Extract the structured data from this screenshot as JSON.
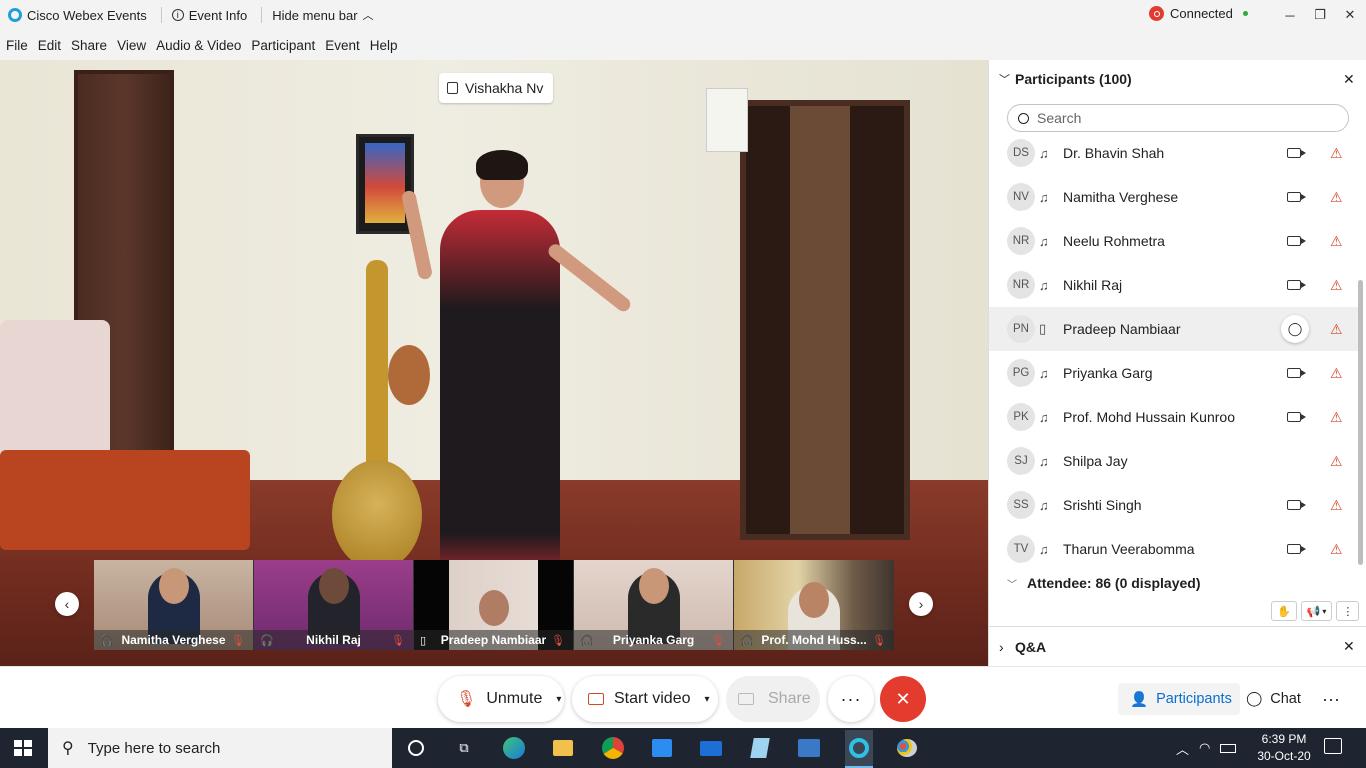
{
  "titlebar": {
    "app_name": "Cisco Webex Events",
    "event_info": "Event Info",
    "hide_menu": "Hide menu bar",
    "status": "Connected",
    "colors": {
      "status_dot": "#2bab3a",
      "record_red": "#e03c31"
    }
  },
  "menu": [
    "File",
    "Edit",
    "Share",
    "View",
    "Audio & Video",
    "Participant",
    "Event",
    "Help"
  ],
  "stage": {
    "active_speaker": "Vishakha Nv",
    "thumbnails": [
      {
        "name": "Namitha Verghese",
        "icon": "headset-icon"
      },
      {
        "name": "Nikhil Raj",
        "icon": "headset-icon"
      },
      {
        "name": "Pradeep Nambiaar",
        "icon": "phone-icon"
      },
      {
        "name": "Priyanka Garg",
        "icon": "headset-icon"
      },
      {
        "name": "Prof. Mohd Huss...",
        "icon": "headset-icon"
      }
    ]
  },
  "participants_panel": {
    "title": "Participants (100)",
    "search_placeholder": "Search",
    "rows": [
      {
        "initials": "DS",
        "name": "Dr. Bhavin Shah",
        "audio": "headset-icon",
        "video": true,
        "chat": false
      },
      {
        "initials": "NV",
        "name": "Namitha Verghese",
        "audio": "headset-icon",
        "video": true,
        "chat": false
      },
      {
        "initials": "NR",
        "name": "Neelu Rohmetra",
        "audio": "headset-icon",
        "video": true,
        "chat": false
      },
      {
        "initials": "NR",
        "name": "Nikhil Raj",
        "audio": "headset-icon",
        "video": true,
        "chat": false
      },
      {
        "initials": "PN",
        "name": "Pradeep Nambiaar",
        "audio": "phone-icon",
        "video": false,
        "chat": true,
        "selected": true
      },
      {
        "initials": "PG",
        "name": "Priyanka Garg",
        "audio": "headset-icon",
        "video": true,
        "chat": false
      },
      {
        "initials": "PK",
        "name": "Prof. Mohd Hussain Kunroo",
        "audio": "headset-icon",
        "video": true,
        "chat": false
      },
      {
        "initials": "SJ",
        "name": "Shilpa Jay",
        "audio": "headset-icon",
        "video": false,
        "chat": false
      },
      {
        "initials": "SS",
        "name": "Srishti Singh",
        "audio": "headset-icon",
        "video": true,
        "chat": false
      },
      {
        "initials": "TV",
        "name": "Tharun Veerabomma",
        "audio": "headset-icon",
        "video": true,
        "chat": false
      }
    ],
    "attendee_label": "Attendee: 86 (0 displayed)",
    "qa_label": "Q&A"
  },
  "controls": {
    "unmute": "Unmute",
    "start_video": "Start video",
    "share": "Share",
    "participants": "Participants",
    "chat": "Chat",
    "colors": {
      "leave": "#e33b2e",
      "accent": "#0a6ed1",
      "mute_red": "#d4482a"
    }
  },
  "taskbar": {
    "search_placeholder": "Type here to search",
    "time": "6:39 PM",
    "date": "30-Oct-20"
  }
}
